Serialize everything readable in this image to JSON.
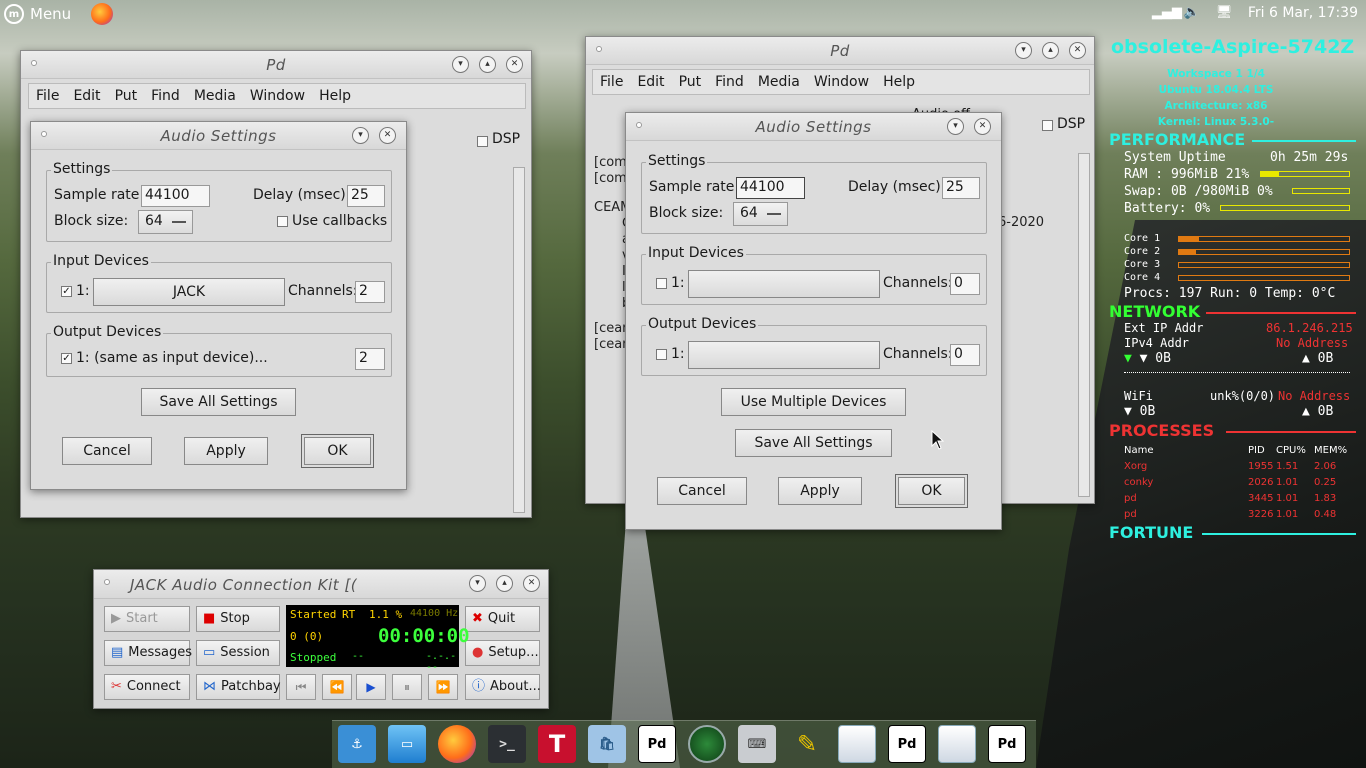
{
  "panel": {
    "menu_label": "Menu",
    "clock": "Fri  6 Mar, 17:39"
  },
  "pd_left": {
    "title": "Pd",
    "menus": [
      "File",
      "Edit",
      "Put",
      "Find",
      "Media",
      "Window",
      "Help"
    ],
    "dsp_label": "DSP"
  },
  "pd_right": {
    "title": "Pd",
    "menus": [
      "File",
      "Edit",
      "Put",
      "Find",
      "Media",
      "Window",
      "Help"
    ],
    "dsp_label": "DSP",
    "header_fragment": "Audio off",
    "log_lines": [
      "[com",
      "[com",
      "CEAM",
      "[cean",
      "[cean"
    ],
    "log_indent": [
      "C",
      "a",
      "v",
      "I",
      "l",
      "b"
    ],
    "date_fragment": "6-2020"
  },
  "audio_left": {
    "title": "Audio Settings",
    "settings_legend": "Settings",
    "sample_rate_label": "Sample rate:",
    "sample_rate": "44100",
    "delay_label": "Delay (msec):",
    "delay": "25",
    "block_size_label": "Block size:",
    "block_size": "64",
    "callbacks_label": "Use callbacks",
    "input_legend": "Input Devices",
    "input_index": "1:",
    "input_device": "JACK",
    "channels_label": "Channels:",
    "input_channels": "2",
    "output_legend": "Output Devices",
    "output_device": "1:  (same as input device)...",
    "output_channels": "2",
    "save_all": "Save All Settings",
    "cancel": "Cancel",
    "apply": "Apply",
    "ok": "OK"
  },
  "audio_right": {
    "title": "Audio Settings",
    "settings_legend": "Settings",
    "sample_rate_label": "Sample rate:",
    "sample_rate": "44100",
    "delay_label": "Delay (msec):",
    "delay": "25",
    "block_size_label": "Block size:",
    "block_size": "64",
    "input_legend": "Input Devices",
    "input_index": "1:",
    "channels_label": "Channels:",
    "input_channels": "0",
    "output_legend": "Output Devices",
    "output_index": "1:",
    "output_channels": "0",
    "multiple": "Use Multiple Devices",
    "save_all": "Save All Settings",
    "cancel": "Cancel",
    "apply": "Apply",
    "ok": "OK"
  },
  "jack": {
    "title": "JACK Audio Connection Kit [(",
    "start": "Start",
    "stop": "Stop",
    "quit": "Quit",
    "messages": "Messages",
    "session": "Session",
    "setup": "Setup...",
    "connect": "Connect",
    "patchbay": "Patchbay",
    "about": "About...",
    "lcd": {
      "state": "Started",
      "rt": "RT",
      "dsp": "1.1 %",
      "rate": "44100 Hz",
      "xruns": "0 (0)",
      "time": "00:00:00",
      "transport": "Stopped",
      "dash1": "--",
      "dash2": "-.-.---"
    }
  },
  "conky": {
    "hostname": "obsolete-Aspire-5742Z",
    "workspace": "Workspace 1 1/4",
    "os": "Ubuntu 18.04.4 LTS",
    "arch": "Architecture: x86",
    "kernel": "Kernel: Linux 5.3.0-",
    "performance": "PERFORMANCE",
    "uptime_label": "System Uptime",
    "uptime": "0h 25m 29s",
    "ram": "RAM : 996MiB 21%",
    "ram_pct": 21,
    "swap": "Swap: 0B  /980MiB 0%",
    "swap_pct": 0,
    "battery": "Battery: 0%",
    "battery_pct": 0,
    "cores": [
      {
        "label": "Core 1",
        "pct": 12
      },
      {
        "label": "Core 2",
        "pct": 10
      },
      {
        "label": "Core 3",
        "pct": 0
      },
      {
        "label": "Core 4",
        "pct": 0
      }
    ],
    "procs": "Procs: 197  Run: 0 Temp: 0°C",
    "network": "NETWORK",
    "ext_ip_label": "Ext IP Addr",
    "ext_ip": "86.1.246.215",
    "ipv4_label": "IPv4 Addr",
    "ipv4": "No Address",
    "down1": "▼ 0B",
    "up1": "▲ 0B",
    "wifi_label": "WiFi",
    "wifi_val": "unk%(0/0)",
    "wifi_addr": "No Address",
    "down2": "▼ 0B",
    "up2": "▲ 0B",
    "processes": "PROCESSES",
    "proc_head": [
      "Name",
      "PID",
      "CPU%",
      "MEM%"
    ],
    "procs_list": [
      [
        "Xorg",
        "1955",
        "1.51",
        "2.06"
      ],
      [
        "conky",
        "2026",
        "1.01",
        "0.25"
      ],
      [
        "pd",
        "3445",
        "1.01",
        "1.83"
      ],
      [
        "pd",
        "3226",
        "1.01",
        "0.48"
      ]
    ],
    "fortune": "FORTUNE"
  },
  "colors": {
    "accent_cyan": "#2ef0e0",
    "accent_red": "#ee3333",
    "bar_yellow": "#e8e800",
    "bar_orange": "#e07a12"
  }
}
